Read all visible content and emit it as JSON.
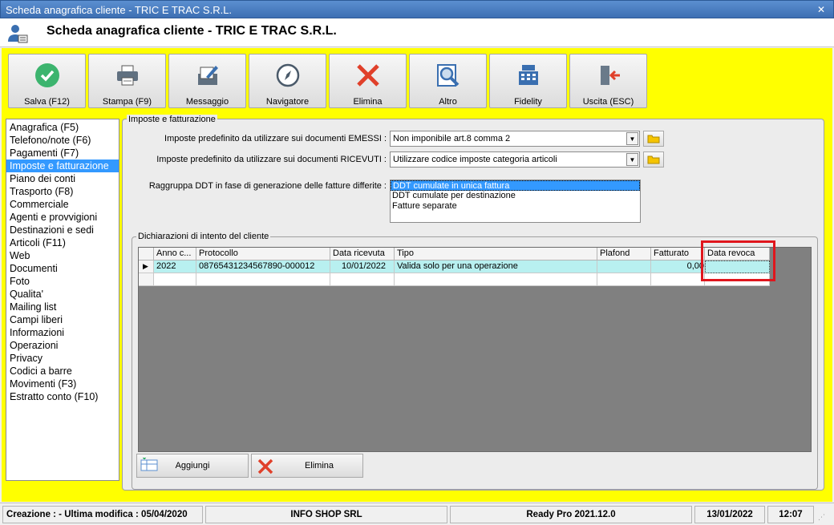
{
  "window": {
    "title": "Scheda anagrafica cliente - TRIC E TRAC S.R.L.",
    "close_glyph": "✕"
  },
  "header": {
    "title": "Scheda anagrafica cliente - TRIC E TRAC S.R.L.",
    "icon": "user-card-icon"
  },
  "toolbar": [
    {
      "label": "Salva (F12)",
      "icon": "check-circle-icon"
    },
    {
      "label": "Stampa (F9)",
      "icon": "printer-icon"
    },
    {
      "label": "Messaggio",
      "icon": "compose-message-icon"
    },
    {
      "label": "Navigatore",
      "icon": "compass-icon"
    },
    {
      "label": "Elimina",
      "icon": "red-x-icon"
    },
    {
      "label": "Altro",
      "icon": "magnifier-document-icon"
    },
    {
      "label": "Fidelity",
      "icon": "cash-register-icon"
    },
    {
      "label": "Uscita (ESC)",
      "icon": "exit-door-icon"
    }
  ],
  "sidebar": {
    "items": [
      "Anagrafica (F5)",
      "Telefono/note (F6)",
      "Pagamenti (F7)",
      "Imposte e fatturazione",
      "Piano dei conti",
      "Trasporto (F8)",
      "Commerciale",
      "Agenti e provvigioni",
      "Destinazioni e sedi",
      "Articoli (F11)",
      "Web",
      "Documenti",
      "Foto",
      "Qualita'",
      "Mailing list",
      "Campi liberi",
      "Informazioni",
      "Operazioni",
      "Privacy",
      "Codici a barre",
      "Movimenti (F3)",
      "Estratto conto (F10)"
    ],
    "selected_index": 3
  },
  "taxes": {
    "group_title": "Imposte e fatturazione",
    "emessi_label": "Imposte predefinito da utilizzare sui documenti EMESSI :",
    "emessi_value": "Non imponibile art.8 comma 2",
    "ricevuti_label": "Imposte predefinito da utilizzare sui documenti RICEVUTI :",
    "ricevuti_value": "Utilizzare codice imposte categoria articoli",
    "ddt_label": "Raggruppa DDT in fase di generazione delle fatture differite :",
    "ddt_options": [
      "DDT cumulate in unica fattura",
      "DDT cumulate per destinazione",
      "Fatture separate"
    ],
    "ddt_selected": 0
  },
  "intent": {
    "group_title": "Dichiarazioni di intento del cliente",
    "columns": [
      "Anno c...",
      "Protocollo",
      "Data ricevuta",
      "Tipo",
      "Plafond",
      "Fatturato",
      "Data revoca"
    ],
    "rows": [
      [
        "2022",
        "08765431234567890-000012",
        "10/01/2022",
        "Valida solo per una operazione",
        "",
        "0,00",
        ""
      ]
    ],
    "row_indicator": "▶",
    "add_label": "Aggiungi",
    "delete_label": "Elimina",
    "highlight_color": "#e0161d"
  },
  "status": {
    "creation": "Creazione :  - Ultima modifica : 05/04/2020",
    "company": "INFO SHOP SRL",
    "version": "Ready Pro 2021.12.0",
    "date": "13/01/2022",
    "time": "12:07"
  },
  "colors": {
    "background": "#ffff00",
    "selection": "#3399ff",
    "row": "#b8f0f0"
  }
}
